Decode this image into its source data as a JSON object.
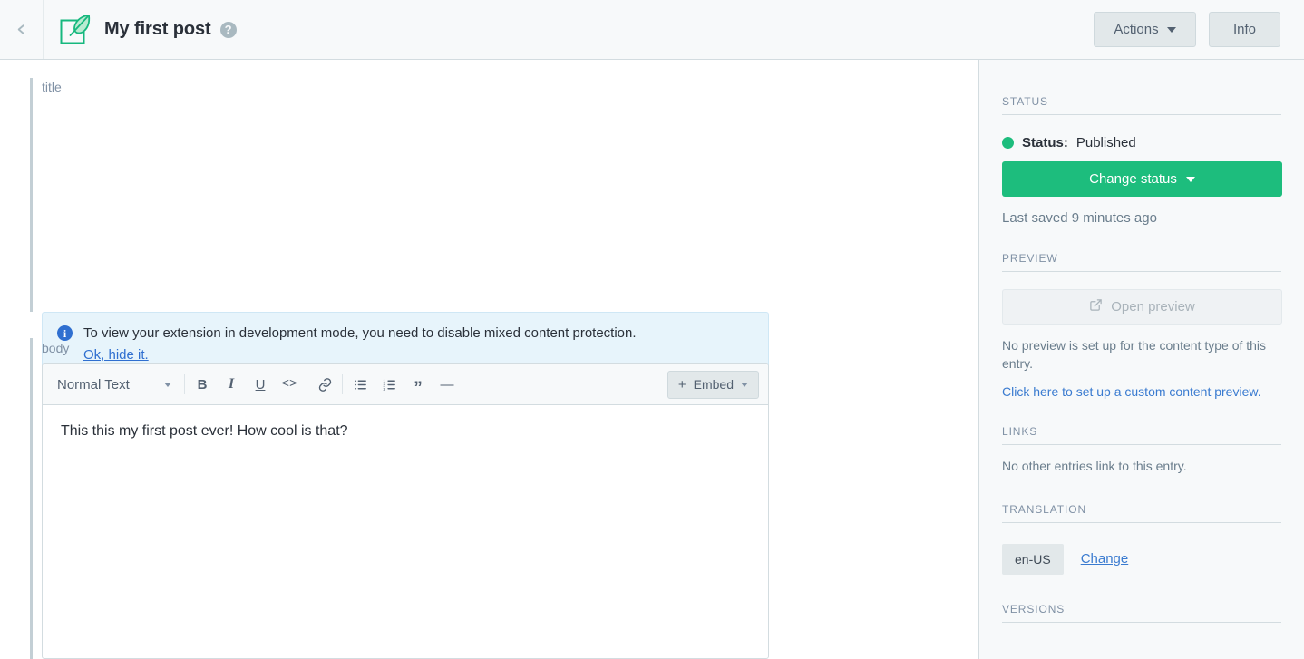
{
  "header": {
    "back_icon": "chevron-left-icon",
    "logo_icon": "leaf-entry-icon",
    "title": "My first post",
    "help_icon": "help-circle-icon",
    "actions_label": "Actions",
    "info_label": "Info"
  },
  "fields": {
    "title": {
      "label": "title",
      "value": "",
      "placeholder": ""
    },
    "body": {
      "label": "body",
      "value": "This this my first post ever! How cool is that?"
    }
  },
  "banner": {
    "icon": "info-circle-icon",
    "text": "To view your extension in development mode, you need to disable mixed content protection.",
    "link": "Ok, hide it."
  },
  "editor_toolbar": {
    "style_value": "Normal Text",
    "buttons": [
      {
        "name": "bold-icon",
        "glyph": "B"
      },
      {
        "name": "italic-icon",
        "glyph": "I"
      },
      {
        "name": "underline-icon",
        "glyph": "U"
      },
      {
        "name": "code-icon",
        "glyph": "<>"
      },
      {
        "name": "link-icon",
        "glyph": "link"
      },
      {
        "name": "bulleted-list-icon",
        "glyph": "ul"
      },
      {
        "name": "numbered-list-icon",
        "glyph": "ol"
      },
      {
        "name": "blockquote-icon",
        "glyph": "”"
      },
      {
        "name": "horizontal-rule-icon",
        "glyph": "—"
      }
    ],
    "embed_label": "Embed",
    "embed_plus": "+"
  },
  "sidebar": {
    "status": {
      "heading": "STATUS",
      "label": "Status:",
      "value": "Published",
      "dot_color": "#1dbd7d",
      "change_button": "Change status",
      "last_saved": "Last saved 9 minutes ago"
    },
    "preview": {
      "heading": "PREVIEW",
      "open_button": "Open preview",
      "open_icon": "external-link-icon",
      "note": "No preview is set up for the content type of this entry.",
      "link": "Click here to set up a custom content preview."
    },
    "links": {
      "heading": "LINKS",
      "note": "No other entries link to this entry."
    },
    "translation": {
      "heading": "TRANSLATION",
      "locale": "en-US",
      "change_link": "Change"
    },
    "versions": {
      "heading": "VERSIONS"
    }
  },
  "colors": {
    "accent_green": "#1dbd7d",
    "link_blue": "#3a7bd0",
    "banner_blue": "#e7f4fb",
    "sidebar_bg": "#f7f9fa"
  }
}
